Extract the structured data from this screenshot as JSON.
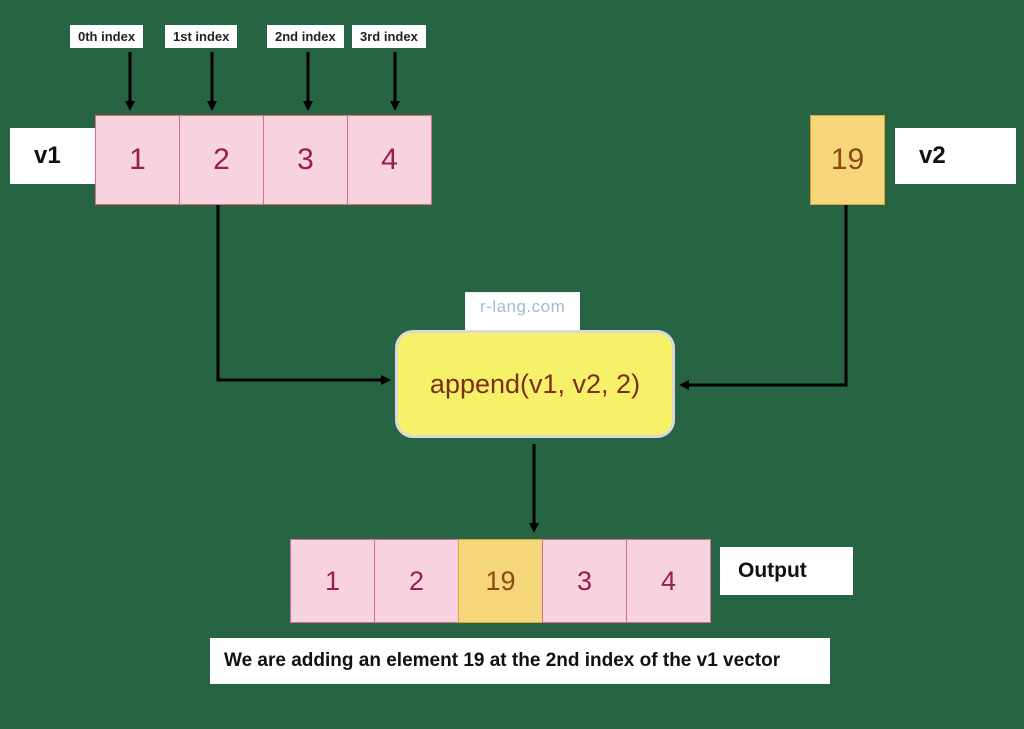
{
  "watermark": "r-lang.com",
  "index_labels": [
    "0th index",
    "1st index",
    "2nd index",
    "3rd index"
  ],
  "v1": {
    "tag": "v1",
    "cells": [
      "1",
      "2",
      "3",
      "4"
    ]
  },
  "v2": {
    "tag": "v2",
    "cells": [
      "19"
    ]
  },
  "function_text": "append(v1, v2, 2)",
  "output": {
    "tag": "Output",
    "cells": [
      {
        "value": "1",
        "kind": "pink"
      },
      {
        "value": "2",
        "kind": "pink"
      },
      {
        "value": "19",
        "kind": "gold"
      },
      {
        "value": "3",
        "kind": "pink"
      },
      {
        "value": "4",
        "kind": "pink"
      }
    ]
  },
  "caption": "We are adding an element 19 at the 2nd index of the v1 vector"
}
